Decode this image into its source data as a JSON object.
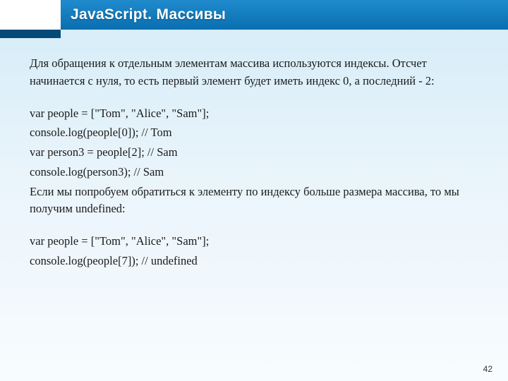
{
  "header": {
    "title": "JavaScript. Массивы"
  },
  "body": {
    "p1": "Для обращения к отдельным элементам массива используются индексы. Отсчет начинается с нуля, то есть первый элемент будет иметь индекс 0, а последний - 2:",
    "c1": "var people = [\"Tom\", \"Alice\", \"Sam\"];",
    "c2": "console.log(people[0]); // Tom",
    "c3": "var person3 = people[2]; // Sam",
    "c4": "console.log(person3); // Sam",
    "p2": "Если мы попробуем обратиться к элементу по индексу больше размера массива, то мы получим undefined:",
    "c5": "var people = [\"Tom\", \"Alice\", \"Sam\"];",
    "c6": "console.log(people[7]); // undefined"
  },
  "page_number": "42"
}
